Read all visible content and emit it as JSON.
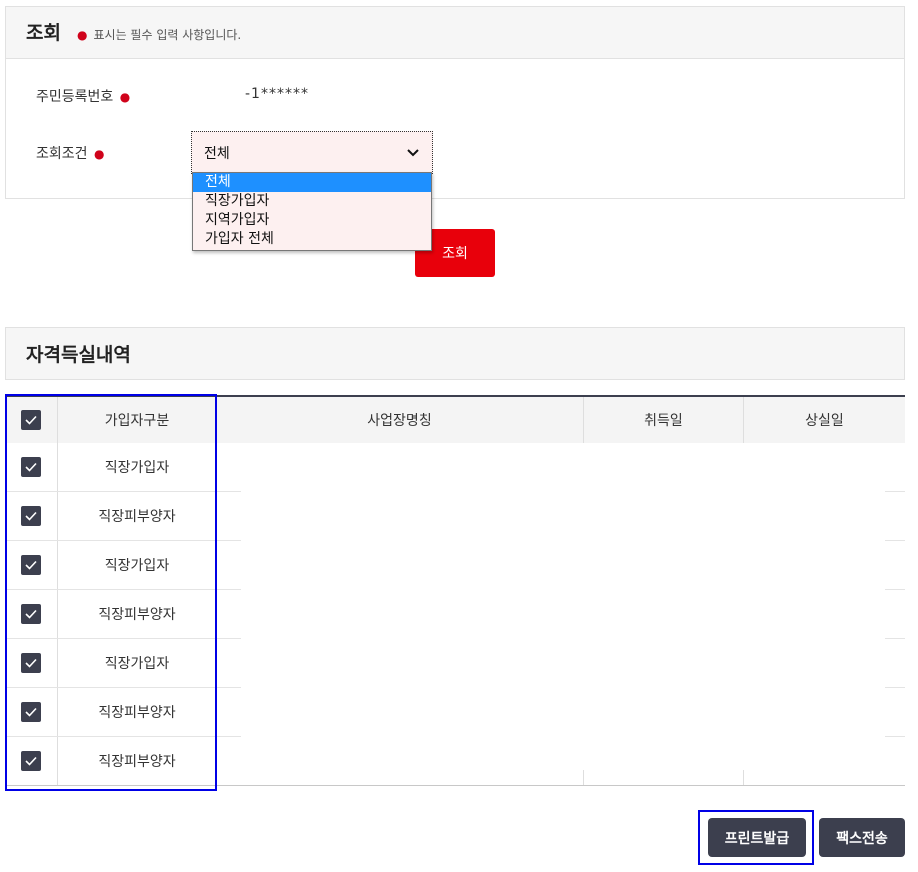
{
  "search": {
    "title": "조회",
    "required_hint": "표시는 필수 입력 사항입니다.",
    "resident_label": "주민등록번호",
    "resident_value": "-1******",
    "condition_label": "조회조건",
    "condition_selected": "전체",
    "condition_options": [
      "전체",
      "직장가입자",
      "지역가입자",
      "가입자 전체"
    ],
    "submit_label": "조회"
  },
  "history": {
    "title": "자격득실내역",
    "columns": [
      "가입자구분",
      "사업장명칭",
      "취득일",
      "상실일"
    ],
    "rows": [
      {
        "type": "직장가입자",
        "checked": true
      },
      {
        "type": "직장피부양자",
        "checked": true
      },
      {
        "type": "직장가입자",
        "checked": true
      },
      {
        "type": "직장피부양자",
        "checked": true
      },
      {
        "type": "직장가입자",
        "checked": true
      },
      {
        "type": "직장피부양자",
        "checked": true
      },
      {
        "type": "직장피부양자",
        "checked": true
      }
    ]
  },
  "actions": {
    "print_label": "프린트발급",
    "fax_label": "팩스전송"
  },
  "colors": {
    "accent_red": "#e8000b",
    "dark": "#3c3f4e",
    "highlight": "#0000e6",
    "option_selected": "#1e90ff"
  }
}
